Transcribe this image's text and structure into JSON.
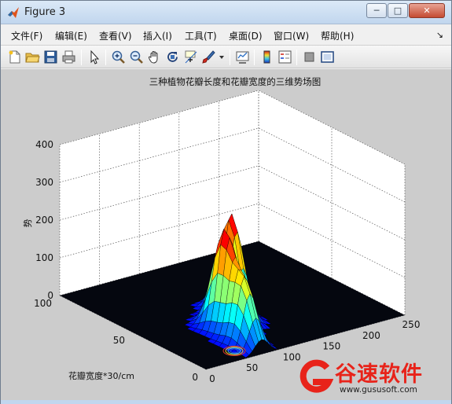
{
  "window": {
    "title": "Figure 3",
    "controls": {
      "minimize": "─",
      "maximize": "□",
      "close": "✕"
    }
  },
  "menubar": {
    "items": [
      {
        "label": "文件(F)"
      },
      {
        "label": "编辑(E)"
      },
      {
        "label": "查看(V)"
      },
      {
        "label": "插入(I)"
      },
      {
        "label": "工具(T)"
      },
      {
        "label": "桌面(D)"
      },
      {
        "label": "窗口(W)"
      },
      {
        "label": "帮助(H)"
      }
    ],
    "dock_arrow": "↘"
  },
  "toolbar": {
    "icons": [
      "new-file-icon",
      "open-folder-icon",
      "save-icon",
      "print-icon",
      "pointer-icon",
      "zoom-in-icon",
      "zoom-out-icon",
      "pan-hand-icon",
      "rotate-3d-icon",
      "data-cursor-icon",
      "brush-icon",
      "dropdown-arrow-icon",
      "link-plot-icon",
      "colorbar-icon",
      "legend-icon",
      "hide-plot-tools-icon",
      "show-plot-tools-icon"
    ]
  },
  "figure": {
    "background": "#cccccc",
    "chart_data": {
      "type": "surface",
      "title": "三种植物花瓣长度和花瓣宽度的三维势场图",
      "xlabel": "",
      "ylabel": "花瓣宽度*30/cm",
      "zlabel": "势",
      "xticks": [
        "0",
        "50",
        "100",
        "150",
        "200",
        "250"
      ],
      "yticks": [
        "0",
        "50",
        "100"
      ],
      "zticks": [
        "0",
        "100",
        "200",
        "300",
        "400"
      ],
      "xlim": [
        0,
        250
      ],
      "ylim": [
        0,
        100
      ],
      "zlim": [
        0,
        400
      ],
      "grid": true,
      "colormap": "jet",
      "series": [
        {
          "peak_x": 75,
          "peak_y": 28,
          "peak_z": 265
        },
        {
          "peak_x": 105,
          "peak_y": 40,
          "peak_z": 275
        },
        {
          "peak_x": 70,
          "peak_y": 12,
          "peak_z": 165
        }
      ]
    }
  },
  "watermark": {
    "text": "谷速软件",
    "url": "www.gususoft.com",
    "color": "#e8231a"
  }
}
